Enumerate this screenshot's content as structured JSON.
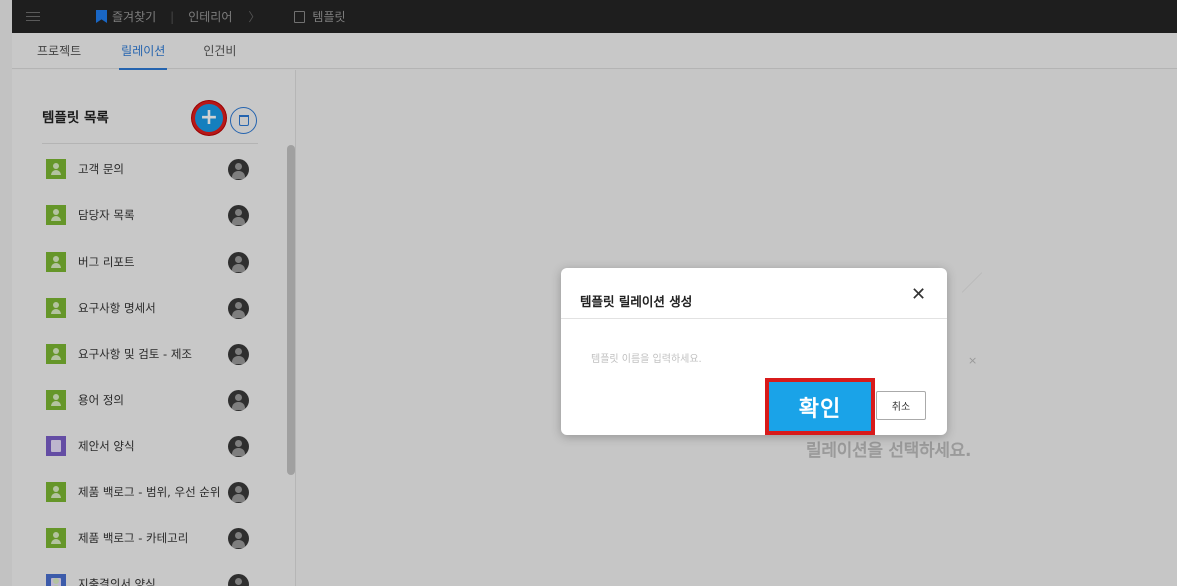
{
  "topbar": {
    "favorites_label": "즐겨찾기",
    "breadcrumb_1": "인테리어",
    "chevron": "〉",
    "current_page": "템플릿"
  },
  "tabs": [
    {
      "label": "프로젝트"
    },
    {
      "label": "릴레이션"
    },
    {
      "label": "인건비"
    }
  ],
  "sidebar": {
    "title": "템플릿 목록",
    "add_icon": "plus",
    "items": [
      {
        "label": "고객 문의",
        "icon": "person-green"
      },
      {
        "label": "담당자 목록",
        "icon": "person-green"
      },
      {
        "label": "버그 리포트",
        "icon": "person-green"
      },
      {
        "label": "요구사항 명세서",
        "icon": "person-green"
      },
      {
        "label": "요구사항 및 검토 - 제조",
        "icon": "person-green"
      },
      {
        "label": "용어 정의",
        "icon": "person-green"
      },
      {
        "label": "제안서 양식",
        "icon": "clipboard-purple"
      },
      {
        "label": "제품 백로그 - 범위, 우선 순위",
        "icon": "person-green"
      },
      {
        "label": "제품 백로그 - 카테고리",
        "icon": "person-green"
      },
      {
        "label": "지출결의서 양식",
        "icon": "clipboard-blue"
      }
    ]
  },
  "main": {
    "hint": "릴레이션을 선택하세요."
  },
  "dialog": {
    "title": "템플릿 릴레이션 생성",
    "input_placeholder": "템플릿 이름을 입력하세요.",
    "ok_label": "확인",
    "cancel_label": "취소"
  },
  "colors": {
    "accent": "#1aa3e8",
    "highlight": "#d81b1b",
    "tab_active": "#2e7bd6",
    "icon_green": "#7cb832"
  }
}
